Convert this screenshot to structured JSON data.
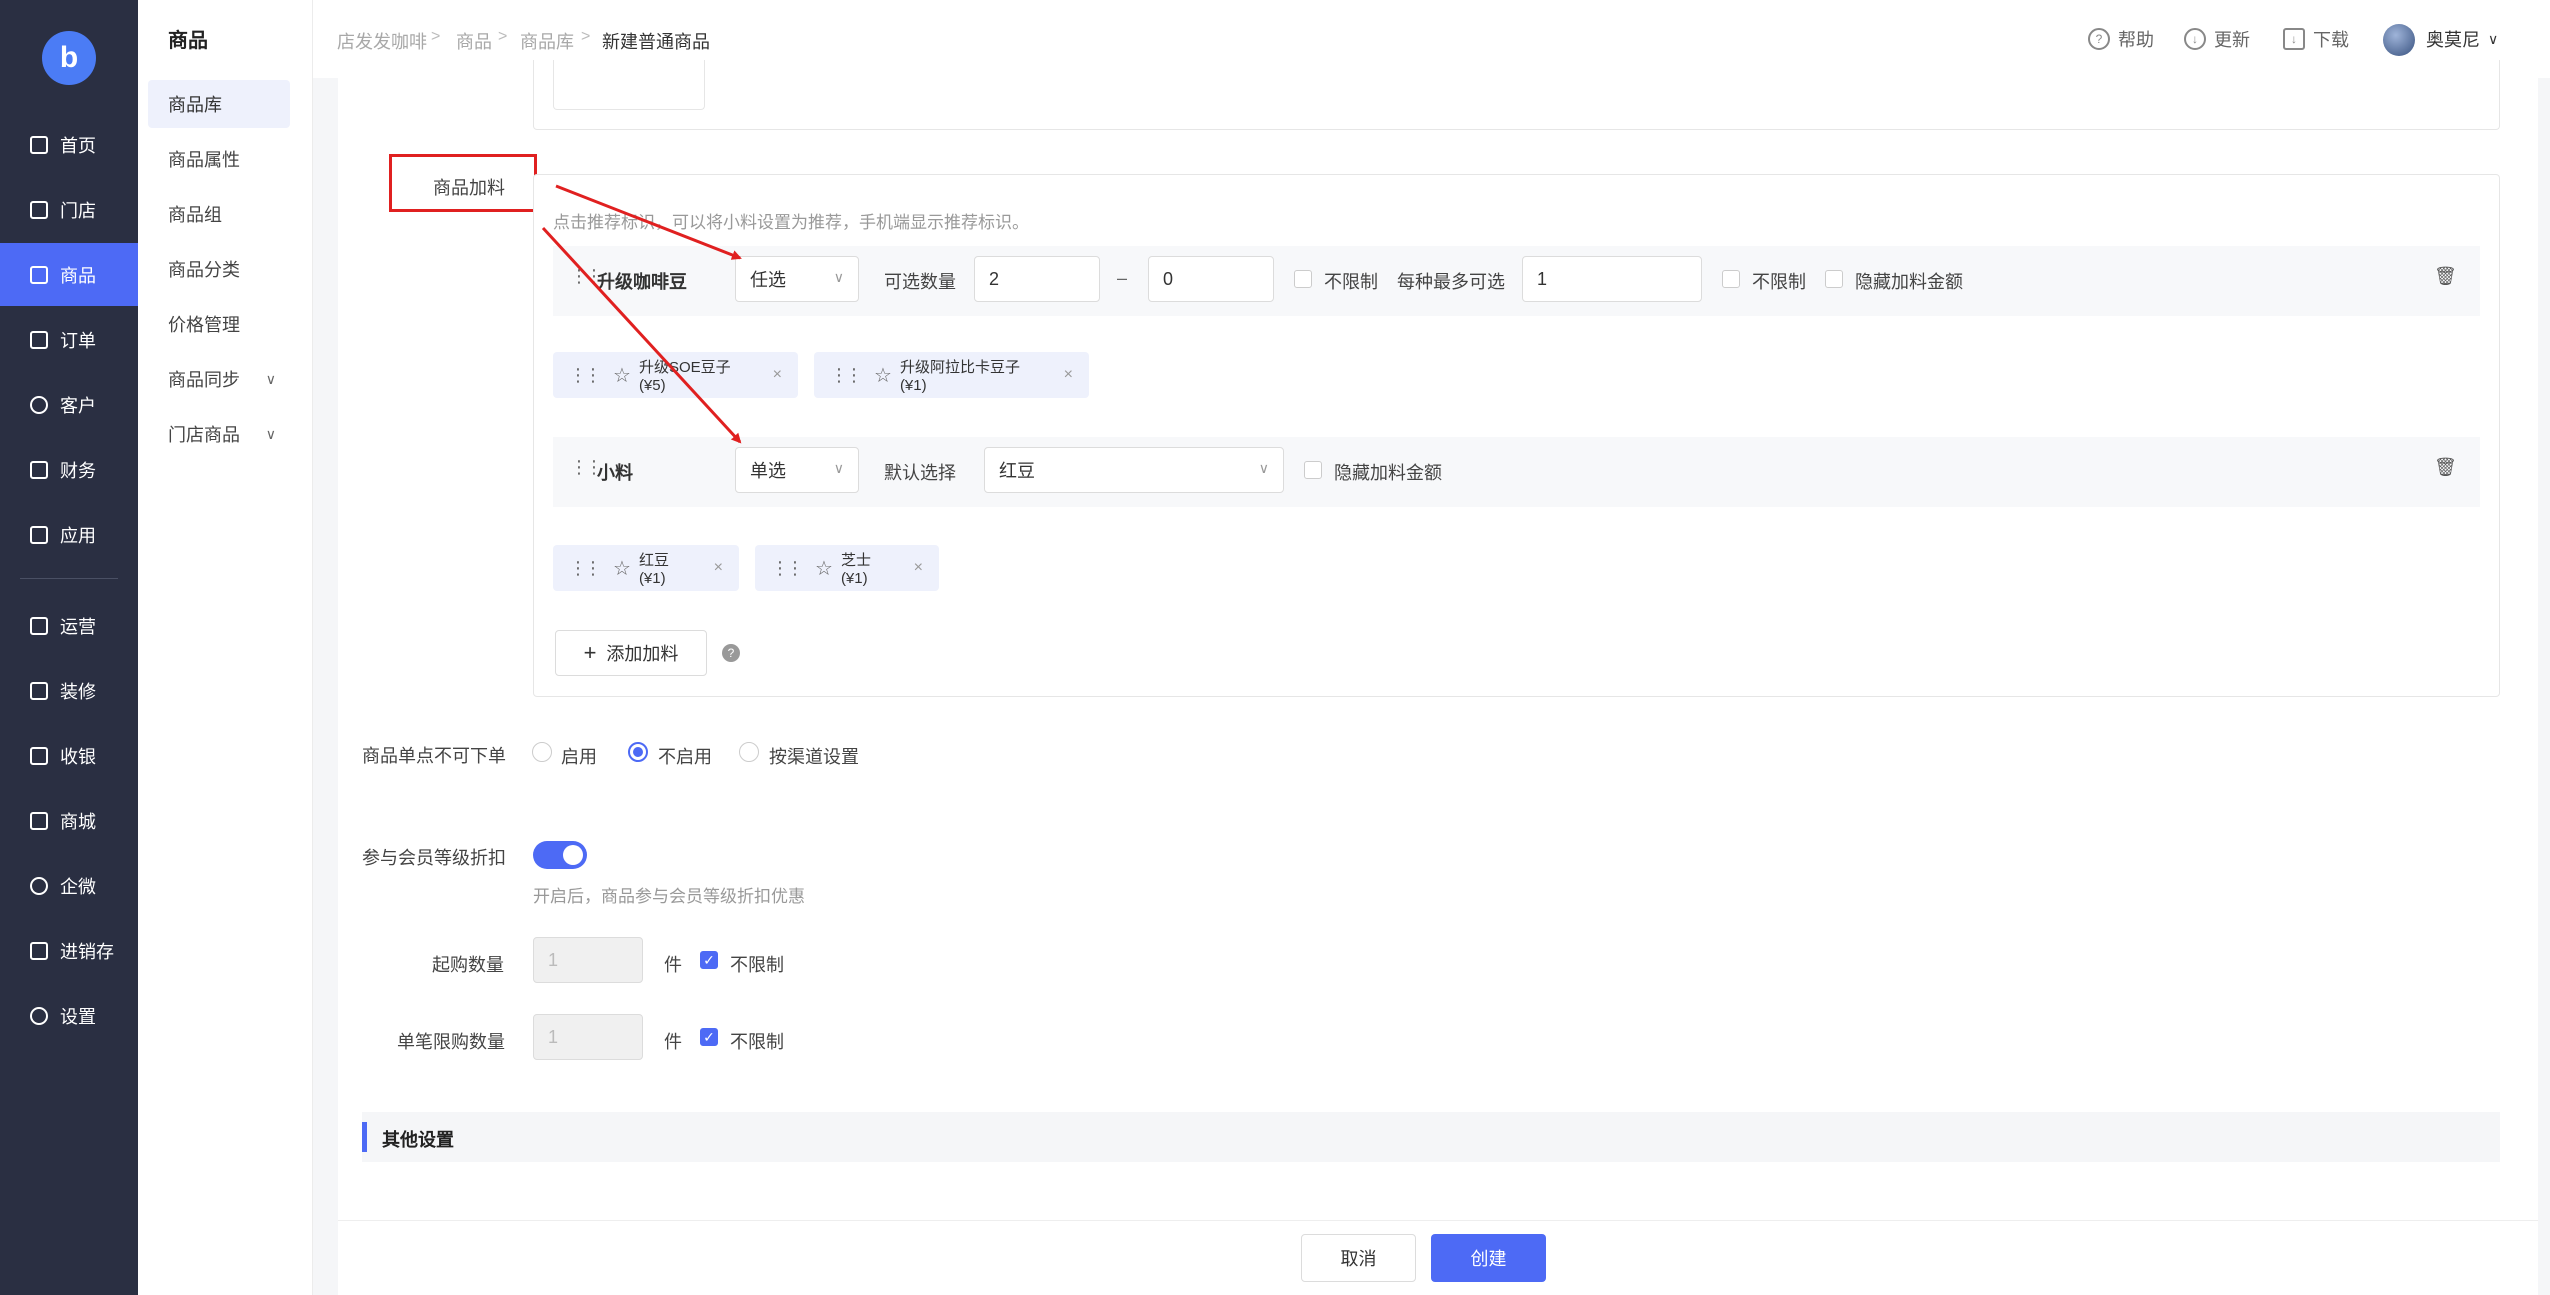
{
  "nav": {
    "logo": "b",
    "items": [
      {
        "label": "首页",
        "icon": "home-icon"
      },
      {
        "label": "门店",
        "icon": "store-icon"
      },
      {
        "label": "商品",
        "icon": "bag-icon"
      },
      {
        "label": "订单",
        "icon": "order-icon"
      },
      {
        "label": "客户",
        "icon": "user-icon"
      },
      {
        "label": "财务",
        "icon": "wallet-icon"
      },
      {
        "label": "应用",
        "icon": "apps-icon"
      },
      {
        "label": "运营",
        "icon": "gift-icon"
      },
      {
        "label": "装修",
        "icon": "layers-icon"
      },
      {
        "label": "收银",
        "icon": "cashier-icon"
      },
      {
        "label": "商城",
        "icon": "mall-icon"
      },
      {
        "label": "企微",
        "icon": "chat-icon"
      },
      {
        "label": "进销存",
        "icon": "inventory-icon"
      },
      {
        "label": "设置",
        "icon": "gear-icon"
      }
    ]
  },
  "subnav": {
    "title": "商品",
    "items": [
      "商品库",
      "商品属性",
      "商品组",
      "商品分类",
      "价格管理",
      "商品同步",
      "门店商品"
    ]
  },
  "header": {
    "breadcrumb": [
      "店发发咖啡",
      "商品",
      "商品库",
      "新建普通商品"
    ],
    "help": "帮助",
    "update": "更新",
    "download": "下载",
    "user": "奥莫尼"
  },
  "addon": {
    "section_label": "商品加料",
    "hint": "点击推荐标识，可以将小料设置为推荐，手机端显示推荐标识。",
    "groups": [
      {
        "name": "升级咖啡豆",
        "mode": "任选",
        "qty_label": "可选数量",
        "qty_min": "2",
        "qty_sep": "–",
        "qty_max": "0",
        "unlimited": "不限制",
        "each_max_label": "每种最多可选",
        "each_max": "1",
        "unlimited2": "不限制",
        "hide_price": "隐藏加料金额",
        "tags": [
          "升级SOE豆子 (¥5)",
          "升级阿拉比卡豆子 (¥1)"
        ]
      },
      {
        "name": "小料",
        "mode": "单选",
        "default_label": "默认选择",
        "default_value": "红豆",
        "hide_price": "隐藏加料金额",
        "tags": [
          "红豆 (¥1)",
          "芝士 (¥1)"
        ]
      }
    ],
    "add_button": "添加加料"
  },
  "single_point": {
    "label": "商品单点不可下单",
    "options": [
      "启用",
      "不启用",
      "按渠道设置"
    ],
    "selected": 1
  },
  "member": {
    "label": "参与会员等级折扣",
    "hint": "开启后，商品参与会员等级折扣优惠"
  },
  "min_qty": {
    "label": "起购数量",
    "value": "1",
    "unit": "件",
    "unlimited": "不限制"
  },
  "max_qty": {
    "label": "单笔限购数量",
    "value": "1",
    "unit": "件",
    "unlimited": "不限制"
  },
  "other": {
    "title": "其他设置"
  },
  "footer": {
    "cancel": "取消",
    "create": "创建"
  },
  "colors": {
    "primary": "#4d6af5",
    "nav_bg": "#2a2f42",
    "annotation": "#e02020"
  }
}
